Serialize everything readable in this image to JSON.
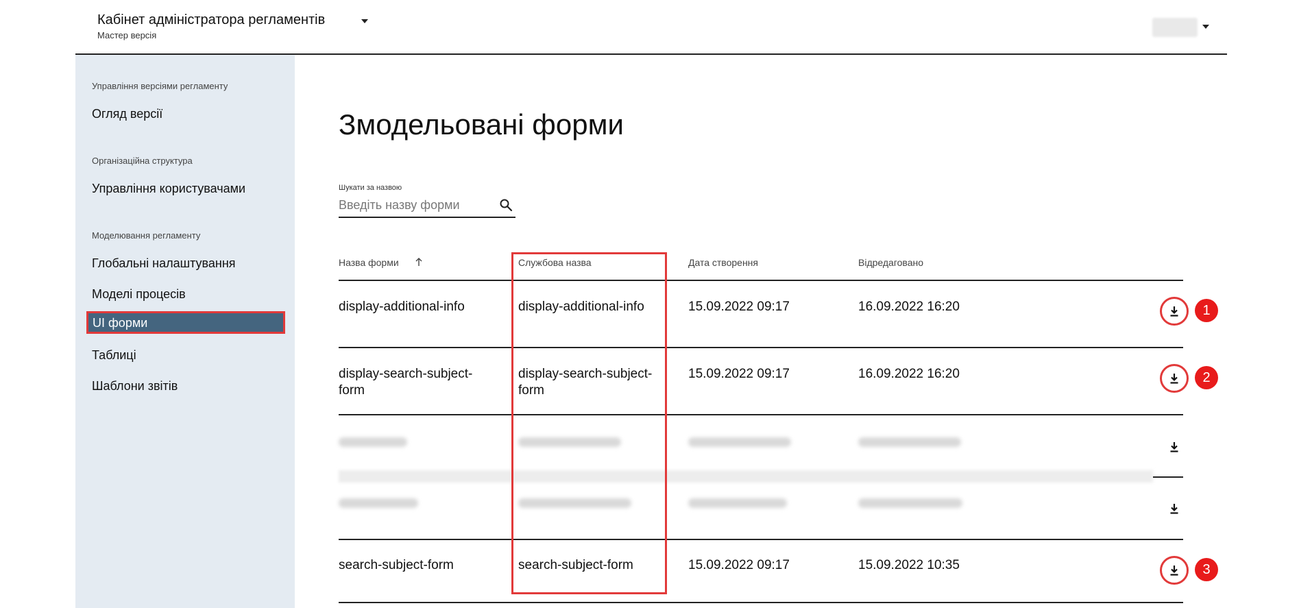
{
  "header": {
    "title": "Кабінет адміністратора регламентів",
    "subtitle": "Мастер версія"
  },
  "sidebar": {
    "sections": [
      {
        "title": "Управління версіями регламенту",
        "items": [
          "Огляд версії"
        ]
      },
      {
        "title": "Організаційна структура",
        "items": [
          "Управління користувачами"
        ]
      },
      {
        "title": "Моделювання регламенту",
        "items": [
          "Глобальні налаштування",
          "Моделі процесів",
          "UI форми",
          "Таблиці",
          "Шаблони звітів"
        ]
      }
    ],
    "active_item": "UI форми"
  },
  "main": {
    "title": "Змодельовані форми",
    "search": {
      "label": "Шукати за назвою",
      "placeholder": "Введіть назву форми",
      "icon": "search-icon"
    },
    "table": {
      "columns": [
        "Назва форми",
        "Службова назва",
        "Дата створення",
        "Відредаговано"
      ],
      "sort": {
        "column": "Назва форми",
        "direction": "asc"
      },
      "rows": [
        {
          "name": "display-additional-info",
          "service_name": "display-additional-info",
          "created": "15.09.2022 09:17",
          "edited": "16.09.2022 16:20",
          "badge": "1",
          "blurred": false
        },
        {
          "name": "display-search-subject-form",
          "service_name": "display-search-subject-form",
          "created": "15.09.2022 09:17",
          "edited": "16.09.2022 16:20",
          "badge": "2",
          "blurred": false
        },
        {
          "name": "",
          "service_name": "",
          "created": "",
          "edited": "",
          "badge": "",
          "blurred": true
        },
        {
          "name": "",
          "service_name": "",
          "created": "",
          "edited": "",
          "badge": "",
          "blurred": true
        },
        {
          "name": "search-subject-form",
          "service_name": "search-subject-form",
          "created": "15.09.2022 09:17",
          "edited": "15.09.2022 10:35",
          "badge": "3",
          "blurred": false
        }
      ]
    }
  },
  "colors": {
    "sidebar_bg": "#e4ebf2",
    "active_bg": "#44657f",
    "annotation_red": "#e23a3a"
  }
}
